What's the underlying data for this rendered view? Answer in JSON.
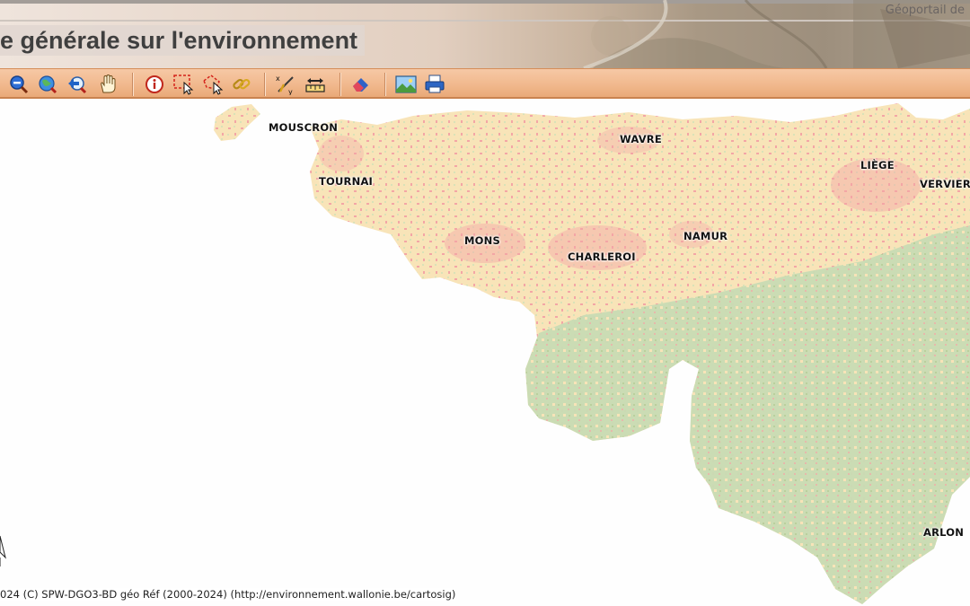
{
  "header": {
    "portal_label": "Géoportail de",
    "title": "e générale sur l'environnement"
  },
  "toolbar": {
    "buttons": [
      {
        "icon": "zoom-out-icon"
      },
      {
        "icon": "zoom-extent-icon"
      },
      {
        "icon": "previous-extent-icon"
      },
      {
        "icon": "pan-hand-icon"
      },
      {
        "icon": "info-icon"
      },
      {
        "icon": "select-rectangle-icon"
      },
      {
        "icon": "select-polygon-icon"
      },
      {
        "icon": "link-icon"
      },
      {
        "icon": "measure-icon"
      },
      {
        "icon": "scale-ruler-icon"
      },
      {
        "icon": "eraser-icon"
      },
      {
        "icon": "export-image-icon"
      },
      {
        "icon": "print-icon"
      }
    ]
  },
  "map": {
    "cities": [
      "MOUSCRON",
      "WAVRE",
      "LIÈGE",
      "TOURNAI",
      "VERVIER",
      "MONS",
      "NAMUR",
      "CHARLEROI",
      "ARLON"
    ],
    "copyright": "024 (C) SPW-DGO3-BD géo Réf (2000-2024) (http://environnement.wallonie.be/cartosig)",
    "colors": {
      "urban": "#f2a7a7",
      "agricultural": "#f8e4b8",
      "forest": "#c9dcb4",
      "background": "#fefefe"
    }
  }
}
